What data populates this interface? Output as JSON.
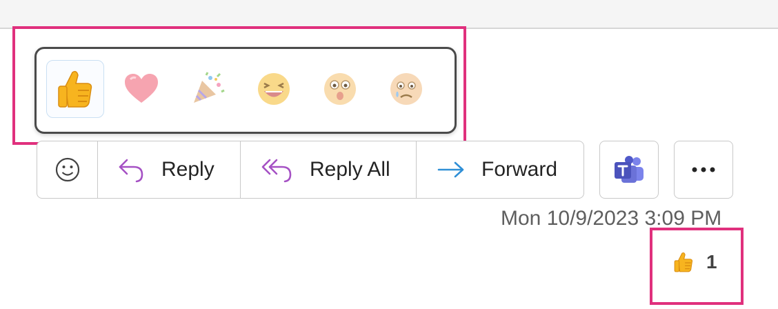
{
  "reactions": [
    {
      "name": "like",
      "icon": "thumbs-up-icon",
      "selected": true
    },
    {
      "name": "heart",
      "icon": "heart-icon",
      "selected": false
    },
    {
      "name": "celebrate",
      "icon": "party-popper-icon",
      "selected": false
    },
    {
      "name": "laugh",
      "icon": "laughing-face-icon",
      "selected": false
    },
    {
      "name": "surprised",
      "icon": "surprised-face-icon",
      "selected": false
    },
    {
      "name": "sad",
      "icon": "sad-face-icon",
      "selected": false
    }
  ],
  "actions": {
    "emoji_icon": "smiley-icon",
    "reply_label": "Reply",
    "reply_all_label": "Reply All",
    "forward_label": "Forward",
    "teams_icon": "teams-icon",
    "more_icon": "more-icon"
  },
  "message": {
    "timestamp": "Mon 10/9/2023 3:09 PM",
    "reaction_icon": "thumbs-up-icon",
    "reaction_count": "1"
  },
  "colors": {
    "highlight": "#e0307d",
    "reply_icon": "#a551c4",
    "forward_icon": "#2f8fd6",
    "teams": "#4b53bc"
  }
}
